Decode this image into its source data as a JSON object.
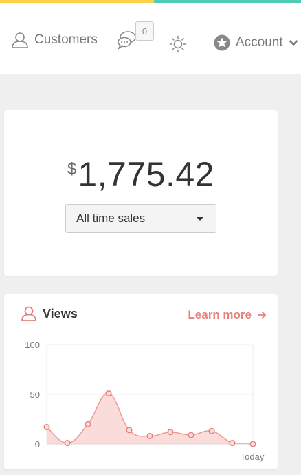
{
  "colors": {
    "yellow": "#fcd34a",
    "teal": "#4ecdb4",
    "accent": "#e8807a",
    "fill": "#fadcda"
  },
  "header": {
    "customers_label": "Customers",
    "messages_count": "0",
    "account_label": "Account"
  },
  "sales": {
    "currency": "$",
    "amount": "1,775.42",
    "range_selected": "All time sales"
  },
  "views": {
    "title": "Views",
    "learn_more": "Learn more",
    "chart_data": {
      "type": "area",
      "title": "Views",
      "x": [
        "",
        "",
        "",
        "",
        "",
        "",
        "",
        "",
        "",
        "",
        "Today"
      ],
      "values": [
        17,
        1,
        20,
        51,
        14,
        8,
        12,
        9,
        13,
        1,
        0
      ],
      "ylim": [
        0,
        100
      ],
      "yticks": [
        0,
        50,
        100
      ],
      "xlabel": "",
      "ylabel": "",
      "grid": true
    }
  }
}
